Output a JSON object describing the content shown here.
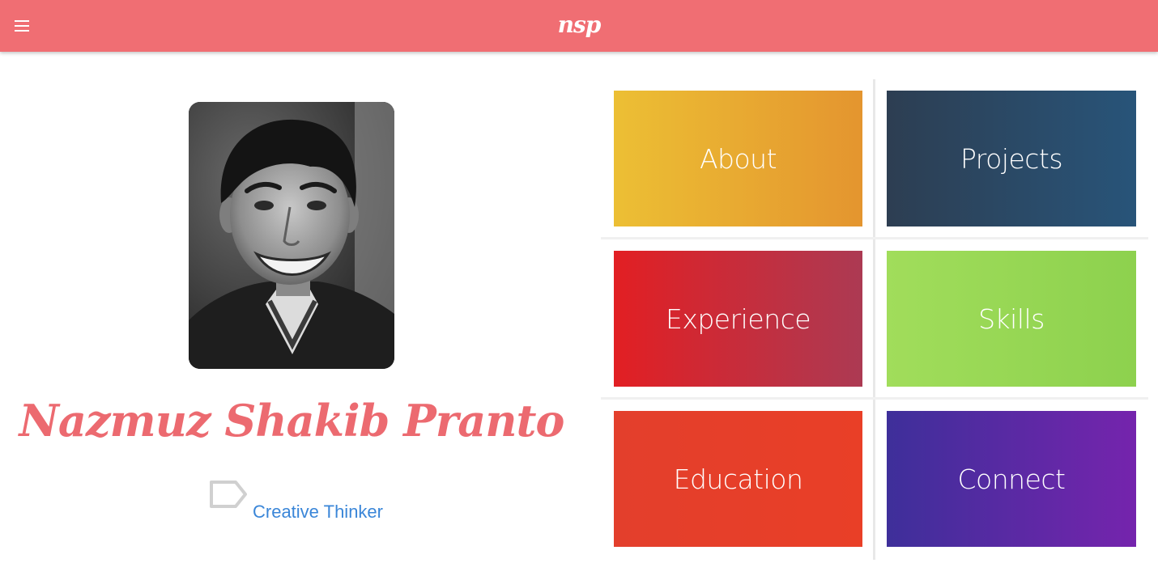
{
  "header": {
    "brand": "nsp",
    "menu_icon": "hamburger-menu-icon",
    "background_color": "#f06e73"
  },
  "profile": {
    "name": "Nazmuz Shakib Pranto",
    "tagline": "Creative Thinker",
    "tag_icon": "tag-icon",
    "name_color": "#ec6a70",
    "tagline_color": "#3a86d8"
  },
  "tiles": [
    {
      "label": "About",
      "gradient_from": "#ecbf34",
      "gradient_to": "#e4952f"
    },
    {
      "label": "Projects",
      "gradient_from": "#2d3e52",
      "gradient_to": "#285479"
    },
    {
      "label": "Experience",
      "gradient_from": "#e21f23",
      "gradient_to": "#ac3a53"
    },
    {
      "label": "Skills",
      "gradient_from": "#a1dd5b",
      "gradient_to": "#8dd14e"
    },
    {
      "label": "Education",
      "gradient_from": "#e33f2c",
      "gradient_to": "#e93f27"
    },
    {
      "label": "Connect",
      "gradient_from": "#3e2f9a",
      "gradient_to": "#7524ad"
    }
  ]
}
